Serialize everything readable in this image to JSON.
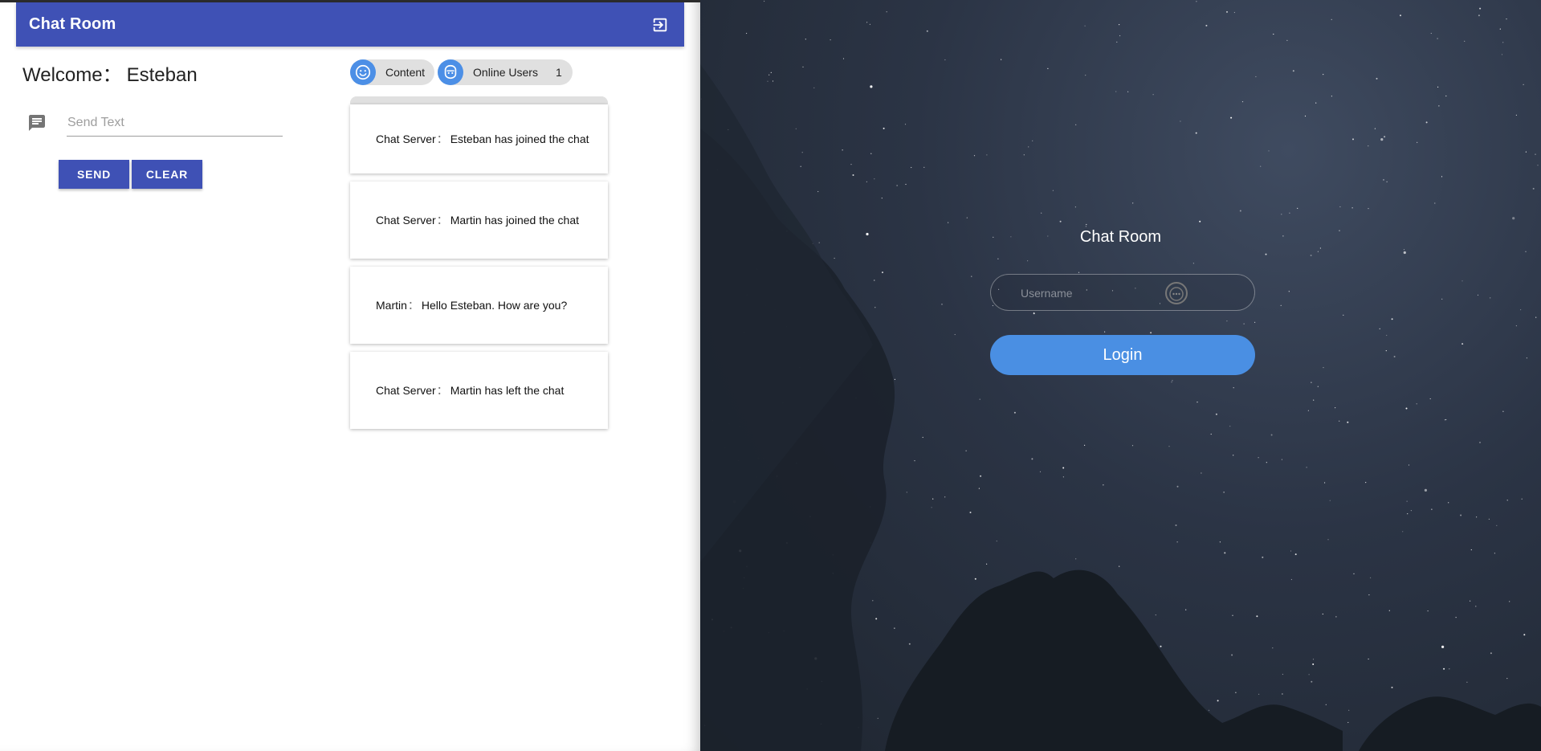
{
  "chat_app": {
    "title": "Chat Room",
    "welcome_label": "Welcome：",
    "username": "Esteban",
    "send_input_placeholder": "Send Text",
    "send_label": "SEND",
    "clear_label": "CLEAR",
    "chips": {
      "content_label": "Content",
      "online_users_label": "Online Users",
      "online_users_count": "1"
    },
    "messages": [
      {
        "sender": "Chat Server",
        "text": "Esteban has joined the chat"
      },
      {
        "sender": "Chat Server",
        "text": "Martin has joined the chat"
      },
      {
        "sender": "Martin",
        "text": "Hello Esteban. How are you?"
      },
      {
        "sender": "Chat Server",
        "text": "Martin has left the chat"
      }
    ],
    "separator": "："
  },
  "login_app": {
    "title": "Chat Room",
    "username_placeholder": "Username",
    "login_label": "Login"
  },
  "colors": {
    "appbar": "#3f51b5",
    "button": "#3f51b5",
    "chip_avatar": "#4c8fe6",
    "login_button": "#4a8fe3"
  },
  "icons": {
    "exit": "exit-to-app-icon",
    "message": "message-icon",
    "content_chip": "smiley-face-icon",
    "online_users_chip": "robot-face-icon",
    "username_field": "password-key-icon"
  }
}
